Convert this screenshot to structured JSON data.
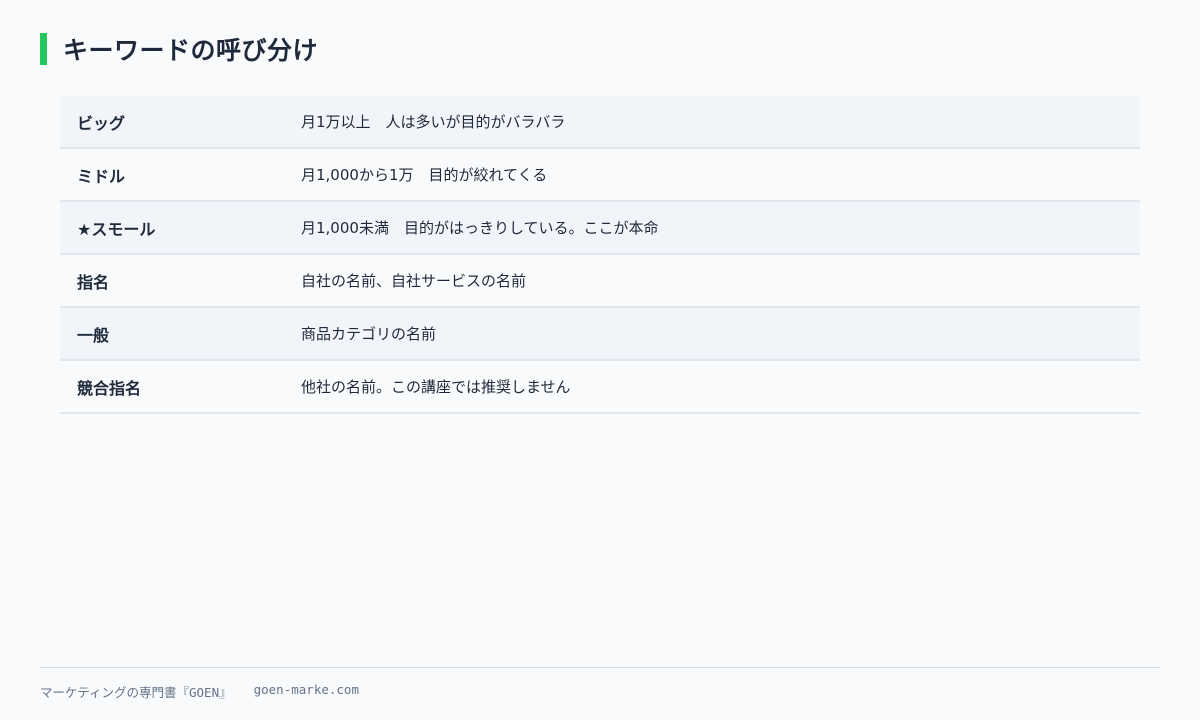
{
  "page": {
    "title": "キーワードの呼び分け"
  },
  "colors": {
    "accent": "#22c55e",
    "background": "#f8fafc",
    "row_alt": "#f1f5f9",
    "text": "#1e293b",
    "footer_text": "#64748b"
  },
  "table": {
    "rows": [
      {
        "name": "ビッグ",
        "desc": "月1万以上　人は多いが目的がバラバラ"
      },
      {
        "name": "ミドル",
        "desc": "月1,000から1万　目的が絞れてくる"
      },
      {
        "name": "★スモール",
        "desc": "月1,000未満　目的がはっきりしている。ここが本命"
      },
      {
        "name": "指名",
        "desc": "自社の名前、自社サービスの名前"
      },
      {
        "name": "一般",
        "desc": "商品カテゴリの名前"
      },
      {
        "name": "競合指名",
        "desc": "他社の名前。この講座では推奨しません"
      }
    ]
  },
  "footer": {
    "brand": "マーケティングの専門書『GOEN』",
    "site": "goen-marke.com"
  }
}
